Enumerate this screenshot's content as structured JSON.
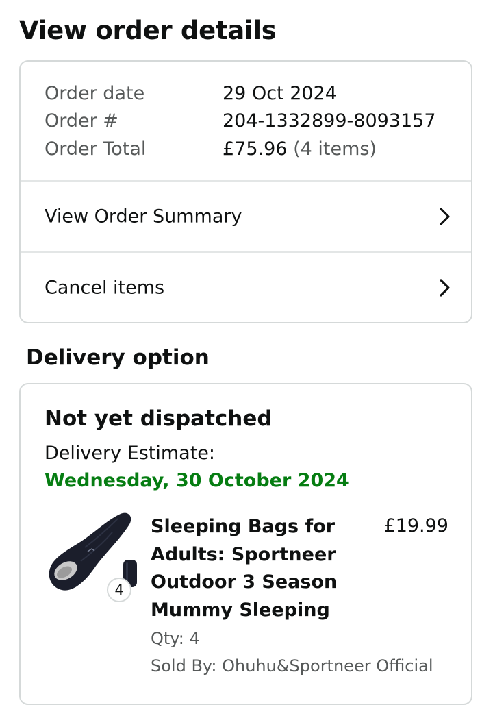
{
  "page": {
    "title": "View order details"
  },
  "order_info": {
    "date_label": "Order date",
    "date_value": "29 Oct 2024",
    "number_label": "Order #",
    "number_value": "204-1332899-8093157",
    "total_label": "Order Total",
    "total_value": "£75.96",
    "total_items": "(4 items)"
  },
  "links": {
    "view_summary": "View Order Summary",
    "cancel_items": "Cancel items"
  },
  "delivery": {
    "section_title": "Delivery option",
    "status": "Not yet dispatched",
    "estimate_label": "Delivery Estimate:",
    "estimate_date": "Wednesday, 30 October 2024",
    "status_color": "#067d12"
  },
  "product": {
    "title": "Sleeping Bags for Adults: Sportneer Outdoor 3 Season Mummy Sleeping",
    "price": "£19.99",
    "qty_badge": "4",
    "qty_text": "Qty: 4",
    "seller": "Sold By: Ohuhu&Sportneer Official",
    "image_icon": "sleeping-bag-image"
  },
  "icons": {
    "chevron": "chevron-right-icon"
  }
}
